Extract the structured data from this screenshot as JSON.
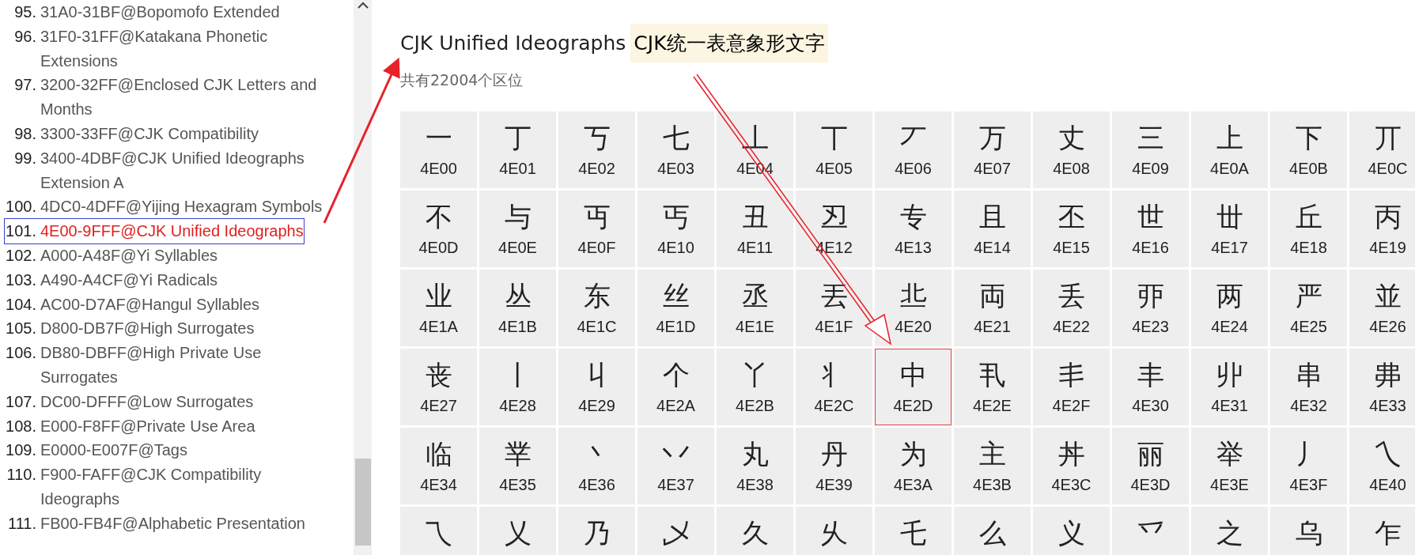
{
  "sidebar": {
    "items": [
      {
        "number": "95.",
        "label": "31A0-31BF@Bopomofo Extended",
        "selected": false
      },
      {
        "number": "96.",
        "label": "31F0-31FF@Katakana Phonetic Extensions",
        "selected": false
      },
      {
        "number": "97.",
        "label": "3200-32FF@Enclosed CJK Letters and Months",
        "selected": false
      },
      {
        "number": "98.",
        "label": "3300-33FF@CJK Compatibility",
        "selected": false
      },
      {
        "number": "99.",
        "label": "3400-4DBF@CJK Unified Ideographs Extension A",
        "selected": false
      },
      {
        "number": "100.",
        "label": "4DC0-4DFF@Yijing Hexagram Symbols",
        "selected": false
      },
      {
        "number": "101.",
        "label": "4E00-9FFF@CJK Unified Ideographs",
        "selected": true
      },
      {
        "number": "102.",
        "label": "A000-A48F@Yi Syllables",
        "selected": false
      },
      {
        "number": "103.",
        "label": "A490-A4CF@Yi Radicals",
        "selected": false
      },
      {
        "number": "104.",
        "label": "AC00-D7AF@Hangul Syllables",
        "selected": false
      },
      {
        "number": "105.",
        "label": "D800-DB7F@High Surrogates",
        "selected": false
      },
      {
        "number": "106.",
        "label": "DB80-DBFF@High Private Use Surrogates",
        "selected": false
      },
      {
        "number": "107.",
        "label": "DC00-DFFF@Low Surrogates",
        "selected": false
      },
      {
        "number": "108.",
        "label": "E000-F8FF@Private Use Area",
        "selected": false
      },
      {
        "number": "109.",
        "label": "E0000-E007F@Tags",
        "selected": false
      },
      {
        "number": "110.",
        "label": "F900-FAFF@CJK Compatibility Ideographs",
        "selected": false
      },
      {
        "number": "111.",
        "label": "FB00-FB4F@Alphabetic Presentation",
        "selected": false
      }
    ]
  },
  "title": {
    "text": "CJK Unified Ideographs",
    "highlight": "CJK统一表意象形文字"
  },
  "subtitle": "共有22004个区位",
  "grid": {
    "cells": [
      {
        "char": "一",
        "code": "4E00",
        "selected": false
      },
      {
        "char": "丁",
        "code": "4E01",
        "selected": false
      },
      {
        "char": "丂",
        "code": "4E02",
        "selected": false
      },
      {
        "char": "七",
        "code": "4E03",
        "selected": false
      },
      {
        "char": "丄",
        "code": "4E04",
        "selected": false
      },
      {
        "char": "丅",
        "code": "4E05",
        "selected": false
      },
      {
        "char": "丆",
        "code": "4E06",
        "selected": false
      },
      {
        "char": "万",
        "code": "4E07",
        "selected": false
      },
      {
        "char": "丈",
        "code": "4E08",
        "selected": false
      },
      {
        "char": "三",
        "code": "4E09",
        "selected": false
      },
      {
        "char": "上",
        "code": "4E0A",
        "selected": false
      },
      {
        "char": "下",
        "code": "4E0B",
        "selected": false
      },
      {
        "char": "丌",
        "code": "4E0C",
        "selected": false
      },
      {
        "char": "不",
        "code": "4E0D",
        "selected": false
      },
      {
        "char": "与",
        "code": "4E0E",
        "selected": false
      },
      {
        "char": "丏",
        "code": "4E0F",
        "selected": false
      },
      {
        "char": "丐",
        "code": "4E10",
        "selected": false
      },
      {
        "char": "丑",
        "code": "4E11",
        "selected": false
      },
      {
        "char": "丒",
        "code": "4E12",
        "selected": false
      },
      {
        "char": "专",
        "code": "4E13",
        "selected": false
      },
      {
        "char": "且",
        "code": "4E14",
        "selected": false
      },
      {
        "char": "丕",
        "code": "4E15",
        "selected": false
      },
      {
        "char": "世",
        "code": "4E16",
        "selected": false
      },
      {
        "char": "丗",
        "code": "4E17",
        "selected": false
      },
      {
        "char": "丘",
        "code": "4E18",
        "selected": false
      },
      {
        "char": "丙",
        "code": "4E19",
        "selected": false
      },
      {
        "char": "业",
        "code": "4E1A",
        "selected": false
      },
      {
        "char": "丛",
        "code": "4E1B",
        "selected": false
      },
      {
        "char": "东",
        "code": "4E1C",
        "selected": false
      },
      {
        "char": "丝",
        "code": "4E1D",
        "selected": false
      },
      {
        "char": "丞",
        "code": "4E1E",
        "selected": false
      },
      {
        "char": "丟",
        "code": "4E1F",
        "selected": false
      },
      {
        "char": "丠",
        "code": "4E20",
        "selected": false
      },
      {
        "char": "両",
        "code": "4E21",
        "selected": false
      },
      {
        "char": "丢",
        "code": "4E22",
        "selected": false
      },
      {
        "char": "丣",
        "code": "4E23",
        "selected": false
      },
      {
        "char": "两",
        "code": "4E24",
        "selected": false
      },
      {
        "char": "严",
        "code": "4E25",
        "selected": false
      },
      {
        "char": "並",
        "code": "4E26",
        "selected": false
      },
      {
        "char": "丧",
        "code": "4E27",
        "selected": false
      },
      {
        "char": "丨",
        "code": "4E28",
        "selected": false
      },
      {
        "char": "丩",
        "code": "4E29",
        "selected": false
      },
      {
        "char": "个",
        "code": "4E2A",
        "selected": false
      },
      {
        "char": "丫",
        "code": "4E2B",
        "selected": false
      },
      {
        "char": "丬",
        "code": "4E2C",
        "selected": false
      },
      {
        "char": "中",
        "code": "4E2D",
        "selected": true
      },
      {
        "char": "丮",
        "code": "4E2E",
        "selected": false
      },
      {
        "char": "丯",
        "code": "4E2F",
        "selected": false
      },
      {
        "char": "丰",
        "code": "4E30",
        "selected": false
      },
      {
        "char": "丱",
        "code": "4E31",
        "selected": false
      },
      {
        "char": "串",
        "code": "4E32",
        "selected": false
      },
      {
        "char": "丳",
        "code": "4E33",
        "selected": false
      },
      {
        "char": "临",
        "code": "4E34",
        "selected": false
      },
      {
        "char": "丵",
        "code": "4E35",
        "selected": false
      },
      {
        "char": "丶",
        "code": "4E36",
        "selected": false
      },
      {
        "char": "丷",
        "code": "4E37",
        "selected": false
      },
      {
        "char": "丸",
        "code": "4E38",
        "selected": false
      },
      {
        "char": "丹",
        "code": "4E39",
        "selected": false
      },
      {
        "char": "为",
        "code": "4E3A",
        "selected": false
      },
      {
        "char": "主",
        "code": "4E3B",
        "selected": false
      },
      {
        "char": "丼",
        "code": "4E3C",
        "selected": false
      },
      {
        "char": "丽",
        "code": "4E3D",
        "selected": false
      },
      {
        "char": "举",
        "code": "4E3E",
        "selected": false
      },
      {
        "char": "丿",
        "code": "4E3F",
        "selected": false
      },
      {
        "char": "乀",
        "code": "4E40",
        "selected": false
      },
      {
        "char": "乁",
        "selected": false
      },
      {
        "char": "乂",
        "selected": false
      },
      {
        "char": "乃",
        "selected": false
      },
      {
        "char": "乄",
        "selected": false
      },
      {
        "char": "久",
        "selected": false
      },
      {
        "char": "乆",
        "selected": false
      },
      {
        "char": "乇",
        "selected": false
      },
      {
        "char": "么",
        "selected": false
      },
      {
        "char": "义",
        "selected": false
      },
      {
        "char": "乊",
        "selected": false
      },
      {
        "char": "之",
        "selected": false
      },
      {
        "char": "乌",
        "selected": false
      },
      {
        "char": "乍",
        "selected": false
      }
    ]
  }
}
